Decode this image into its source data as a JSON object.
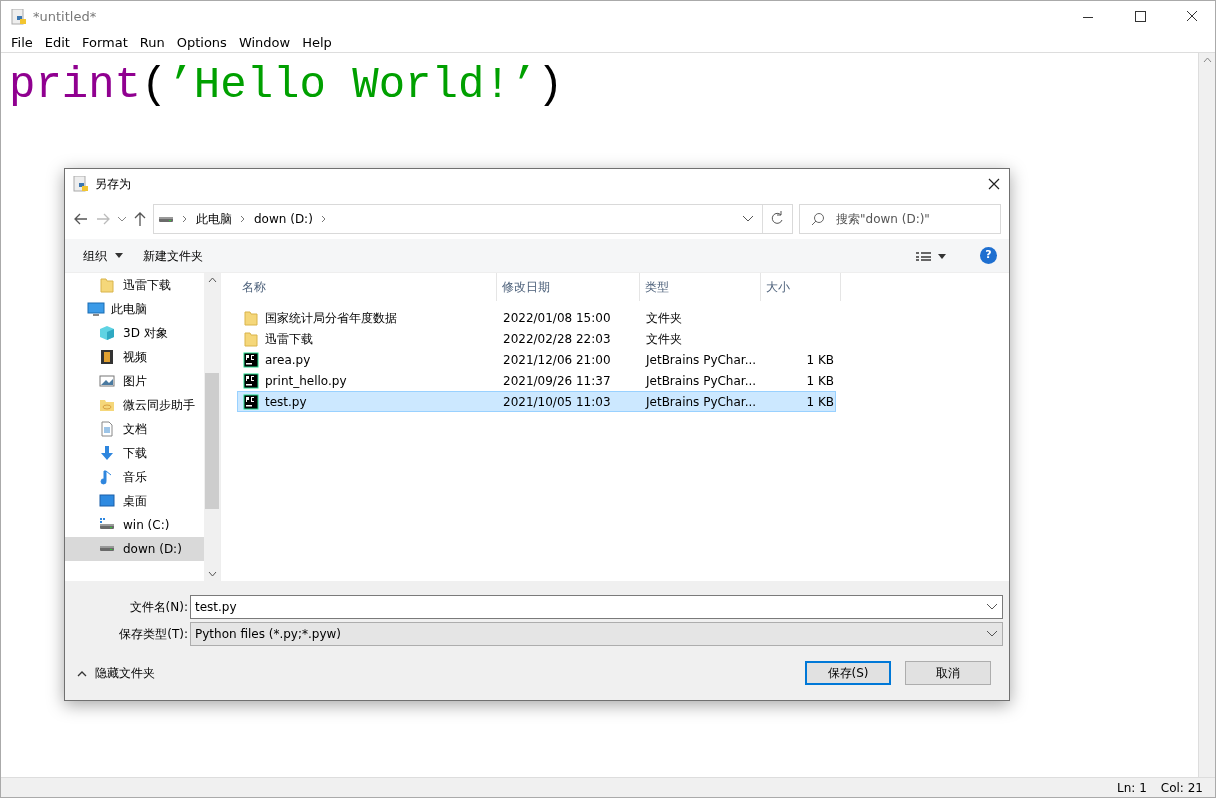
{
  "window": {
    "title": "*untitled*"
  },
  "menu": [
    "File",
    "Edit",
    "Format",
    "Run",
    "Options",
    "Window",
    "Help"
  ],
  "editor": {
    "code": [
      {
        "kind": "keyword",
        "text": "print"
      },
      {
        "kind": "paren",
        "text": "("
      },
      {
        "kind": "string",
        "text": "’Hello World!’"
      },
      {
        "kind": "paren",
        "text": ")"
      }
    ]
  },
  "dialog": {
    "title": "另存为",
    "breadcrumb": [
      "此电脑",
      "down (D:)"
    ],
    "search": {
      "placeholder": "搜索\"down (D:)\""
    },
    "toolbar": {
      "organize": "组织",
      "new_folder": "新建文件夹",
      "help": "?"
    },
    "sidebar": [
      {
        "children": [
          {
            "label": "迅雷下载",
            "kind": "folder",
            "selected": false
          }
        ]
      },
      {
        "label": "此电脑",
        "kind": "pc",
        "selected": false,
        "children": [
          {
            "label": "3D 对象",
            "kind": "cube",
            "selected": false
          },
          {
            "label": "视频",
            "kind": "video",
            "selected": false
          },
          {
            "label": "图片",
            "kind": "picture",
            "selected": false
          },
          {
            "label": "微云同步助手",
            "kind": "cloud-folder",
            "selected": false
          },
          {
            "label": "文档",
            "kind": "document",
            "selected": false
          },
          {
            "label": "下载",
            "kind": "download",
            "selected": false
          },
          {
            "label": "音乐",
            "kind": "music",
            "selected": false
          },
          {
            "label": "桌面",
            "kind": "desktop",
            "selected": false
          },
          {
            "label": "win (C:)",
            "kind": "drive-win",
            "selected": false
          },
          {
            "label": "down (D:)",
            "kind": "drive",
            "selected": true
          }
        ]
      }
    ],
    "columns": [
      "名称",
      "修改日期",
      "类型",
      "大小"
    ],
    "files": [
      {
        "name": "国家统计局分省年度数据",
        "date": "2022/01/08 15:00",
        "type": "文件夹",
        "kind": "folder",
        "selected": false
      },
      {
        "name": "迅雷下载",
        "date": "2022/02/28 22:03",
        "type": "文件夹",
        "kind": "folder",
        "selected": false
      },
      {
        "name": "area.py",
        "date": "2021/12/06 21:00",
        "type": "JetBrains PyChar...",
        "size": "1 KB",
        "kind": "pycharm",
        "selected": false
      },
      {
        "name": "print_hello.py",
        "date": "2021/09/26 11:37",
        "type": "JetBrains PyChar...",
        "size": "1 KB",
        "kind": "pycharm",
        "selected": false
      },
      {
        "name": "test.py",
        "date": "2021/10/05 11:03",
        "type": "JetBrains PyChar...",
        "size": "1 KB",
        "kind": "pycharm",
        "selected": true
      }
    ],
    "filename": {
      "label": "文件名(N):",
      "value": "test.py"
    },
    "filetype": {
      "label": "保存类型(T):",
      "value": "Python files (*.py;*.pyw)"
    },
    "hide_folders": "隐藏文件夹",
    "buttons": [
      {
        "label": "保存(S)",
        "default": true
      },
      {
        "label": "取消",
        "default": false
      }
    ]
  },
  "status_bar": {
    "line": "Ln: 1",
    "col": "Col: 21"
  }
}
